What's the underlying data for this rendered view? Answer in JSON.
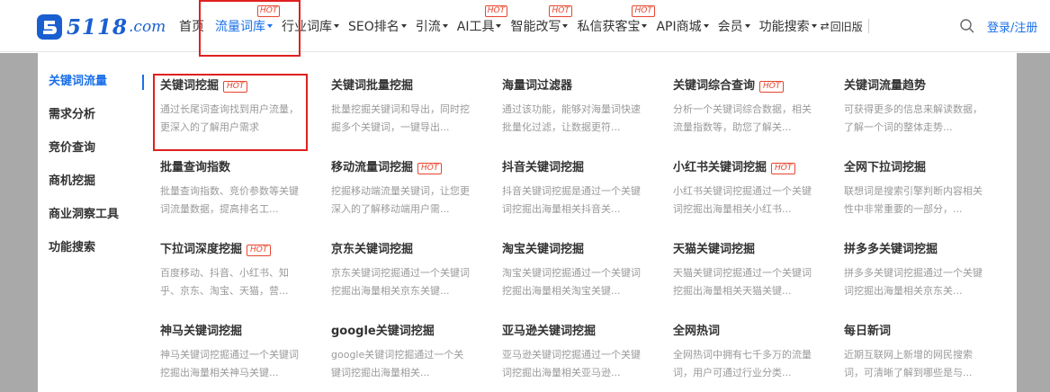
{
  "logo": {
    "brand": "5118",
    "suffix": ".com",
    "color": "#1a5fd0"
  },
  "nav": {
    "items": [
      {
        "label": "首页",
        "caret": false,
        "hot": false
      },
      {
        "label": "流量词库",
        "caret": true,
        "hot": true,
        "active": true
      },
      {
        "label": "行业词库",
        "caret": true,
        "hot": false
      },
      {
        "label": "SEO排名",
        "caret": true,
        "hot": false
      },
      {
        "label": "引流",
        "caret": true,
        "hot": false
      },
      {
        "label": "AI工具",
        "caret": true,
        "hot": true
      },
      {
        "label": "智能改写",
        "caret": true,
        "hot": true
      },
      {
        "label": "私信获客宝",
        "caret": true,
        "hot": true
      },
      {
        "label": "API商城",
        "caret": true,
        "hot": false
      },
      {
        "label": "会员",
        "caret": true,
        "hot": false
      },
      {
        "label": "功能搜索",
        "caret": true,
        "hot": false
      }
    ],
    "hot_label": "HOT",
    "old_version": "回旧版",
    "swap_glyph": "⇄",
    "login": "登录/注册",
    "accent": "#1a6fe8"
  },
  "sidebar": {
    "items": [
      {
        "label": "关键词流量",
        "active": true
      },
      {
        "label": "需求分析"
      },
      {
        "label": "竞价查询"
      },
      {
        "label": "商机挖掘"
      },
      {
        "label": "商业洞察工具"
      },
      {
        "label": "功能搜索"
      }
    ]
  },
  "tools": [
    {
      "title": "关键词挖掘",
      "hot": true,
      "desc": "通过长尾词查询找到用户流量，更深入的了解用户需求"
    },
    {
      "title": "关键词批量挖掘",
      "hot": false,
      "desc": "批量挖掘关键词和导出，同时挖掘多个关键词，一键导出..."
    },
    {
      "title": "海量词过滤器",
      "hot": false,
      "desc": "通过该功能，能够对海量词快速批量化过滤，让数据更符..."
    },
    {
      "title": "关键词综合查询",
      "hot": true,
      "desc": "分析一个关键词综合数据，相关流量指数等，助您了解关..."
    },
    {
      "title": "关键词流量趋势",
      "hot": false,
      "desc": "可获得更多的信息来解读数据，了解一个词的整体走势..."
    },
    {
      "title": "批量查询指数",
      "hot": false,
      "desc": "批量查询指数、竞价参数等关键词流量数据，提高排名工..."
    },
    {
      "title": "移动流量词挖掘",
      "hot": true,
      "desc": "挖掘移动端流量关键词，让您更深入的了解移动端用户需..."
    },
    {
      "title": "抖音关键词挖掘",
      "hot": false,
      "desc": "抖音关键词挖掘是通过一个关键词挖掘出海量相关抖音关..."
    },
    {
      "title": "小红书关键词挖掘",
      "hot": true,
      "desc": "小红书关键词挖掘通过一个关键词挖掘出海量相关小红书..."
    },
    {
      "title": "全网下拉词挖掘",
      "hot": false,
      "desc": "联想词是搜索引擎判断内容相关性中非常重要的一部分，..."
    },
    {
      "title": "下拉词深度挖掘",
      "hot": true,
      "desc": "百度移动、抖音、小红书、知乎、京东、淘宝、天猫，营..."
    },
    {
      "title": "京东关键词挖掘",
      "hot": false,
      "desc": "京东关键词挖掘通过一个关键词挖掘出海量相关京东关键..."
    },
    {
      "title": "淘宝关键词挖掘",
      "hot": false,
      "desc": "淘宝关键词挖掘通过一个关键词挖掘出海量相关淘宝关键..."
    },
    {
      "title": "天猫关键词挖掘",
      "hot": false,
      "desc": "天猫关键词挖掘通过一个关键词挖掘出海量相关天猫关键..."
    },
    {
      "title": "拼多多关键词挖掘",
      "hot": false,
      "desc": "拼多多关键词挖掘通过一个关键词挖掘出海量相关京东关..."
    },
    {
      "title": "神马关键词挖掘",
      "hot": false,
      "desc": "神马关键词挖掘通过一个关键词挖掘出海量相关神马关键..."
    },
    {
      "title": "google关键词挖掘",
      "hot": false,
      "desc": "google关键词挖掘通过一个关键词挖掘出海量相关..."
    },
    {
      "title": "亚马逊关键词挖掘",
      "hot": false,
      "desc": "亚马逊关键词挖掘通过一个关键词挖掘出海量相关亚马逊..."
    },
    {
      "title": "全网热词",
      "hot": false,
      "desc": "全网热词中拥有七千多万的流量词，用户可通过行业分类..."
    },
    {
      "title": "每日新词",
      "hot": false,
      "desc": "近期互联网上新增的网民搜索词，可清晰了解到哪些是与..."
    }
  ],
  "colors": {
    "hot": "#e8452f",
    "highlight": "#e02020",
    "dim": "#a9a9a9"
  }
}
